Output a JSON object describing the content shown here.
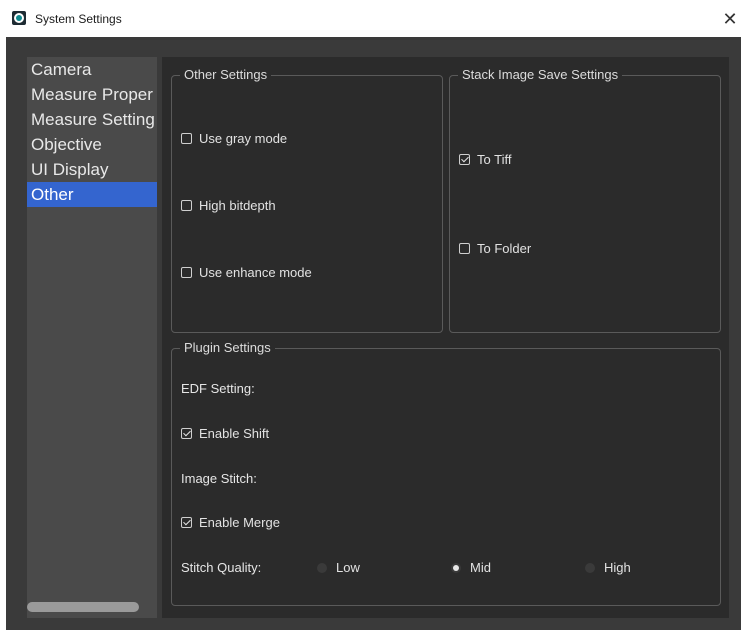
{
  "window": {
    "title": "System Settings"
  },
  "sidebar": {
    "items": [
      {
        "label": "Camera"
      },
      {
        "label": "Measure Proper"
      },
      {
        "label": "Measure Setting"
      },
      {
        "label": "Objective"
      },
      {
        "label": "UI Display"
      },
      {
        "label": "Other",
        "selected": true
      }
    ]
  },
  "other_settings": {
    "title": "Other Settings",
    "options": [
      {
        "label": "Use gray mode",
        "checked": false
      },
      {
        "label": "High bitdepth",
        "checked": false
      },
      {
        "label": "Use enhance mode",
        "checked": false
      }
    ]
  },
  "stack_save": {
    "title": "Stack Image Save Settings",
    "options": [
      {
        "label": "To Tiff",
        "checked": true
      },
      {
        "label": "To Folder",
        "checked": false
      }
    ]
  },
  "plugin": {
    "title": "Plugin Settings",
    "edf_label": "EDF Setting:",
    "enable_shift": {
      "label": "Enable Shift",
      "checked": true
    },
    "stitch_label": "Image Stitch:",
    "enable_merge": {
      "label": "Enable Merge",
      "checked": true
    },
    "quality": {
      "label": "Stitch Quality:",
      "options": [
        "Low",
        "Mid",
        "High"
      ],
      "selected": "Mid"
    }
  },
  "colors": {
    "selection": "#3465cf",
    "panel_bg": "#2b2b2b",
    "window_bg": "#3a3a3a",
    "sidebar_bg": "#4a4a4a"
  }
}
